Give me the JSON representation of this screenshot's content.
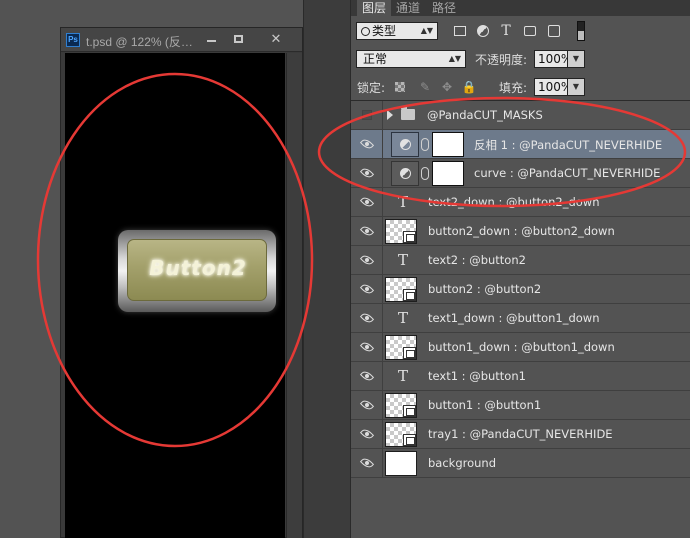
{
  "document": {
    "title": "t.psd @ 122% (反…",
    "app_icon": "Ps",
    "button_text": "Button2"
  },
  "panel": {
    "tabs": [
      {
        "label": "图层",
        "active": true
      },
      {
        "label": "通道",
        "active": false
      },
      {
        "label": "路径",
        "active": false
      }
    ],
    "filter": {
      "kind_label": "类型"
    },
    "blend_mode": "正常",
    "opacity_label": "不透明度:",
    "opacity_value": "100%",
    "lock_label": "锁定:",
    "fill_label": "填充:",
    "fill_value": "100%"
  },
  "layers": [
    {
      "name": "@PandaCUT_MASKS",
      "kind": "group",
      "visible": false,
      "selected": false
    },
    {
      "name": "反相 1 : @PandaCUT_NEVERHIDE",
      "kind": "adjustment",
      "visible": true,
      "selected": true
    },
    {
      "name": "curve : @PandaCUT_NEVERHIDE",
      "kind": "adjustment",
      "visible": true,
      "selected": false
    },
    {
      "name": "text2_down : @button2_down",
      "kind": "text",
      "visible": true,
      "selected": false
    },
    {
      "name": "button2_down : @button2_down",
      "kind": "smart",
      "visible": true,
      "selected": false
    },
    {
      "name": "text2 : @button2",
      "kind": "text",
      "visible": true,
      "selected": false
    },
    {
      "name": "button2 : @button2",
      "kind": "smart",
      "visible": true,
      "selected": false
    },
    {
      "name": "text1_down : @button1_down",
      "kind": "text",
      "visible": true,
      "selected": false
    },
    {
      "name": "button1_down : @button1_down",
      "kind": "smart",
      "visible": true,
      "selected": false
    },
    {
      "name": "text1 : @button1",
      "kind": "text",
      "visible": true,
      "selected": false
    },
    {
      "name": "button1 : @button1",
      "kind": "smart",
      "visible": true,
      "selected": false
    },
    {
      "name": "tray1 : @PandaCUT_NEVERHIDE",
      "kind": "smart",
      "visible": true,
      "selected": false
    },
    {
      "name": "background",
      "kind": "background",
      "visible": true,
      "selected": false
    }
  ],
  "colors": {
    "annotation": "#e53935",
    "selected_row": "#6d7a8b",
    "panel_bg": "#535353"
  }
}
